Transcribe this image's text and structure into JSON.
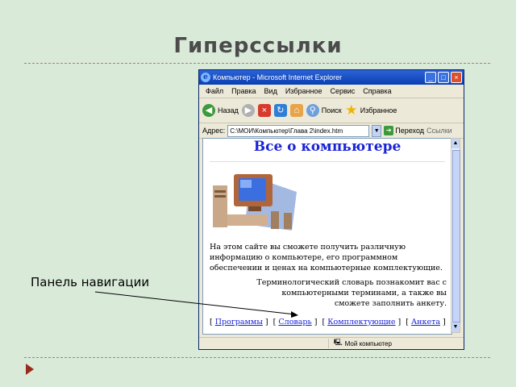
{
  "slide": {
    "title": "Гиперссылки",
    "callout": "Панель навигации"
  },
  "browser": {
    "window_title": "Компьютер - Microsoft Internet Explorer",
    "menu": [
      "Файл",
      "Правка",
      "Вид",
      "Избранное",
      "Сервис",
      "Справка"
    ],
    "toolbar": {
      "back": "Назад",
      "search": "Поиск",
      "favorites": "Избранное"
    },
    "address": {
      "label": "Адрес:",
      "value": "C:\\MOИ\\Компьютер\\Глава 2\\index.htm",
      "go": "Переход",
      "links": "Ссылки"
    },
    "status": "Мой компьютер",
    "colors": {
      "titlebar": "#0a3fb4",
      "link": "#1a24d6"
    }
  },
  "page": {
    "heading": "Все о компьютере",
    "para1": "На этом сайте вы сможете получить различную информацию о компьютере, его программном обеспечении и ценах на компьютерные комплектующие.",
    "para2": "Терминологический словарь познакомит вас с компьютерными терминами, а также вы сможете заполнить анкету.",
    "nav": [
      "Программы",
      "Словарь",
      "Комплектующие",
      "Анкета"
    ]
  }
}
